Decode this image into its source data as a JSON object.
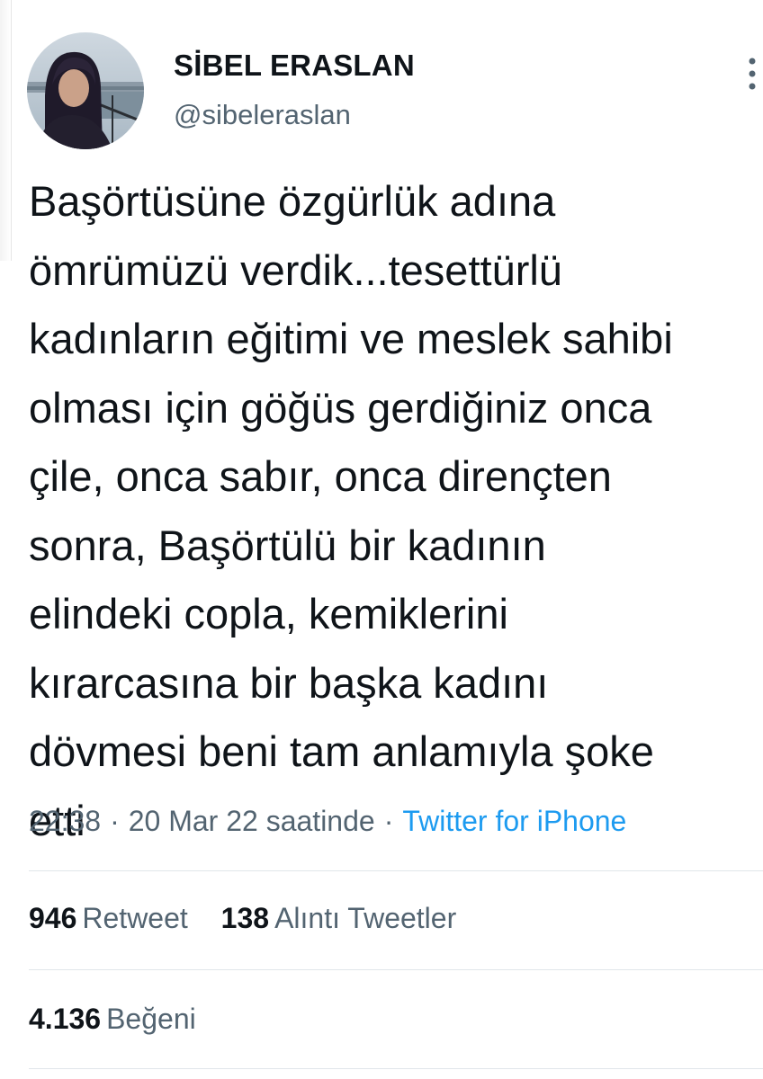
{
  "user": {
    "display_name": "SİBEL ERASLAN",
    "handle": "@sibeleraslan",
    "avatar_icon": "profile-photo"
  },
  "tweet": {
    "lines": [
      "Başörtüsüne özgürlük adına",
      "ömrümüzü verdik...tesettürlü",
      "kadınların eğitimi ve meslek sahibi",
      "olması için göğüs gerdiğiniz onca",
      "çile, onca sabır, onca dirençten",
      "sonra, Başörtülü bir kadının",
      "elindeki copla, kemiklerini",
      "kırarcasına bir başka kadını",
      "dövmesi beni tam anlamıyla şoke",
      "etti"
    ]
  },
  "meta": {
    "time": "22:38",
    "separator": "·",
    "date": "20 Mar 22 saatinde",
    "source": "Twitter for iPhone"
  },
  "stats": {
    "retweets_count": "946",
    "retweets_label": "Retweet",
    "quotes_count": "138",
    "quotes_label": "Alıntı Tweetler",
    "likes_count": "4.136",
    "likes_label": "Beğeni"
  },
  "colors": {
    "text": "#0f1419",
    "secondary": "#536471",
    "link": "#1d9bf0",
    "divider": "#e1e6ea"
  },
  "icons": {
    "more": "more-options-icon"
  }
}
